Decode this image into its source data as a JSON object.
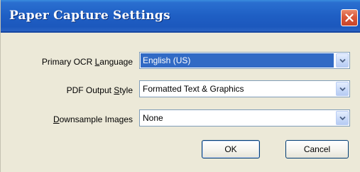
{
  "window": {
    "title": "Paper Capture Settings",
    "close_icon": "close-icon"
  },
  "fields": [
    {
      "label_before": "Primary OCR ",
      "label_accel": "L",
      "label_after": "anguage",
      "value": "English (US)",
      "selected": true
    },
    {
      "label_before": "PDF Output ",
      "label_accel": "S",
      "label_after": "tyle",
      "value": "Formatted Text & Graphics",
      "selected": false
    },
    {
      "label_before": "",
      "label_accel": "D",
      "label_after": "ownsample Images",
      "value": "None",
      "selected": false
    }
  ],
  "buttons": {
    "ok_label": "OK",
    "cancel_label": "Cancel"
  },
  "colors": {
    "titlebar": "#1f5fc4",
    "dialog_bg": "#ece9d8",
    "selection": "#316ac5",
    "close_button": "#d9583a"
  }
}
